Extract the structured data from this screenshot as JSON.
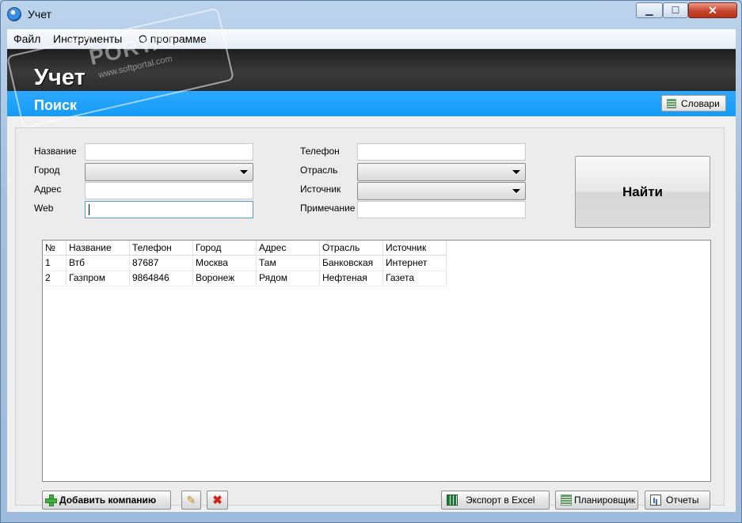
{
  "window": {
    "title": "Учет"
  },
  "menu": {
    "items": [
      "Файл",
      "Инструменты",
      "О программе"
    ]
  },
  "header": {
    "title": "Учет",
    "subtitle": "Поиск",
    "dict_button": "Словари"
  },
  "form": {
    "name_label": "Название",
    "city_label": "Город",
    "address_label": "Адрес",
    "web_label": "Web",
    "phone_label": "Телефон",
    "industry_label": "Отрасль",
    "source_label": "Источник",
    "note_label": "Примечание",
    "name_value": "",
    "address_value": "",
    "web_value": "",
    "phone_value": "",
    "note_value": "",
    "city_selected": "",
    "industry_selected": "",
    "source_selected": ""
  },
  "find_button": "Найти",
  "table": {
    "columns": [
      "№",
      "Название",
      "Телефон",
      "Город",
      "Адрес",
      "Отрасль",
      "Источник"
    ],
    "rows": [
      [
        "1",
        "Втб",
        "87687",
        "Москва",
        "Там",
        "Банковская",
        "Интернет"
      ],
      [
        "2",
        "Газпром",
        "9864846",
        "Воронеж",
        "Рядом",
        "Нефтеная",
        "Газета"
      ]
    ]
  },
  "buttons": {
    "add_company": "Добавить компанию",
    "export_excel": "Экспорт в Excel",
    "scheduler": "Планировщик",
    "reports": "Отчеты"
  },
  "watermark": {
    "text": "PORTAL",
    "sub": "www.softportal.com"
  },
  "colors": {
    "accent_blue": "#149bf5",
    "header_dark": "#2c2c2c"
  }
}
